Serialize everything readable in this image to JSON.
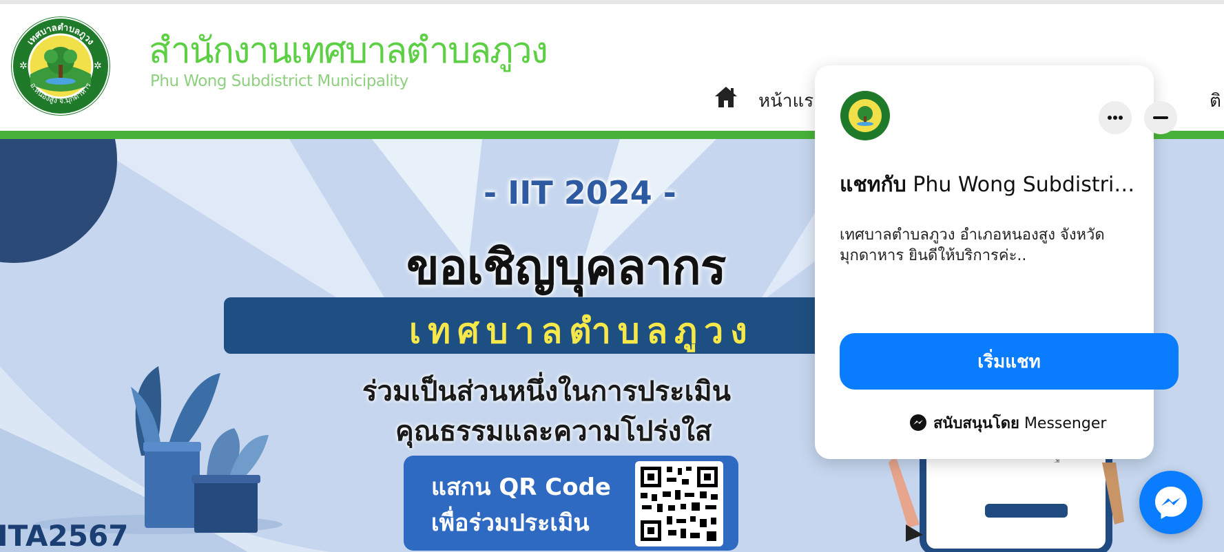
{
  "header": {
    "title": "สำนักงานเทศบาลตำบลภูวง",
    "subtitle": "Phu Wong Subdistrict Municipality",
    "logo_icon": "municipal-seal-icon",
    "logo_ring_text": "เทศบาลตำบลภูวง",
    "logo_bottom_text": "อ.หนองสูง จ.มุกดาหาร"
  },
  "nav": {
    "home_icon": "home-icon",
    "home_label": "หน้าแรก",
    "contact_label_partial": "ติ"
  },
  "banner": {
    "iit_label": "- IIT 2024 -",
    "heading": "ขอเชิญบุคลากร",
    "org_name": "เทศบาลตำบลภูวง",
    "assess_line1": "ร่วมเป็นส่วนหนึ่งในการประเมิน",
    "assess_line2": "คุณธรรมและความโปร่งใส",
    "qr_line1": "แสกน QR Code",
    "qr_line2": "เพื่อร่วมประเมิน",
    "ita_label": "ITA2567",
    "qr_icon": "qr-code-icon",
    "accent_color": "#2d5aa1",
    "band_color": "#1e4f82",
    "band_text_color": "#f6e84a"
  },
  "chat": {
    "title_bold": "แชทกับ",
    "title_rest": "Phu Wong Subdistrict ...",
    "message": "เทศบาลตำบลภูวง อำเภอหนองสูง จังหวัดมุกดาหาร ยินดีให้บริการค่ะ..",
    "start_button": "เริ่มแชท",
    "powered_bold": "สนับสนุนโดย",
    "powered_rest": "Messenger",
    "accent_color": "#0a7cff"
  }
}
